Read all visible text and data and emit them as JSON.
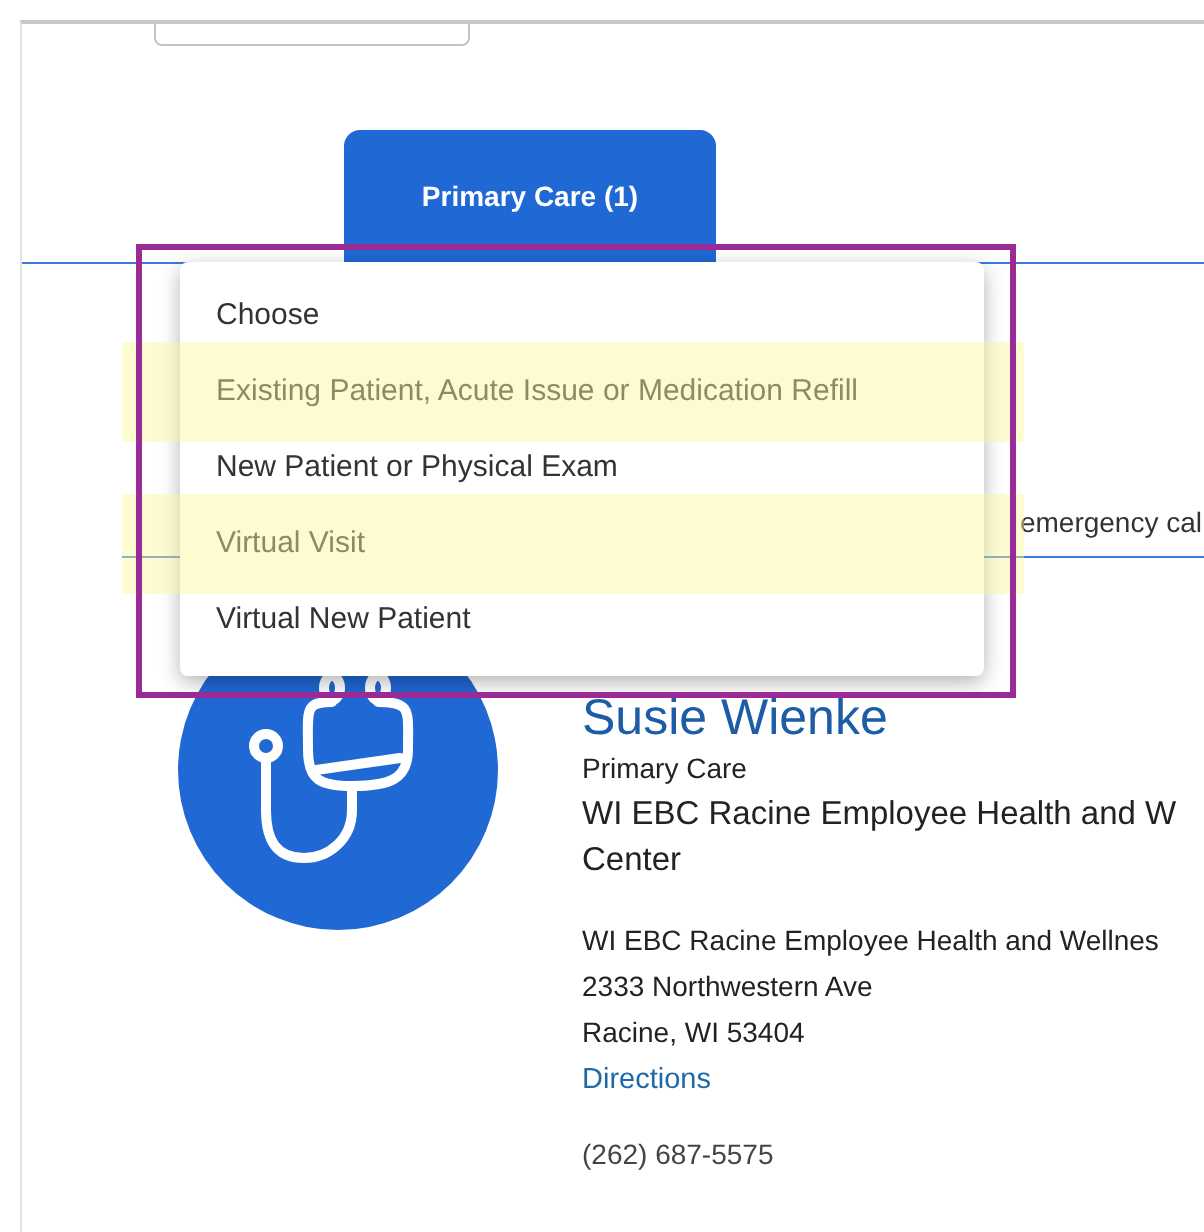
{
  "tabs": [
    {
      "label": "Primary Care (1)",
      "selected": true
    }
  ],
  "notice": {
    "link": "emergency cal"
  },
  "dropdown": {
    "outlined": true,
    "options": [
      {
        "label": "Choose",
        "highlighted": false
      },
      {
        "label": "Existing Patient, Acute Issue or Medication Refill",
        "highlighted": true
      },
      {
        "label": "New Patient or Physical Exam",
        "highlighted": false
      },
      {
        "label": "Virtual Visit",
        "highlighted": true
      },
      {
        "label": "Virtual New Patient",
        "highlighted": false
      }
    ]
  },
  "provider": {
    "name": "Susie Wienke",
    "specialty": "Primary Care",
    "clinic": "WI EBC Racine Employee Health and W Center",
    "location": "WI EBC Racine Employee Health and Wellnes",
    "street": "2333 Northwestern Ave",
    "city": "Racine, WI 53404",
    "directions": "Directions",
    "phone": "(262) 687-5575"
  }
}
